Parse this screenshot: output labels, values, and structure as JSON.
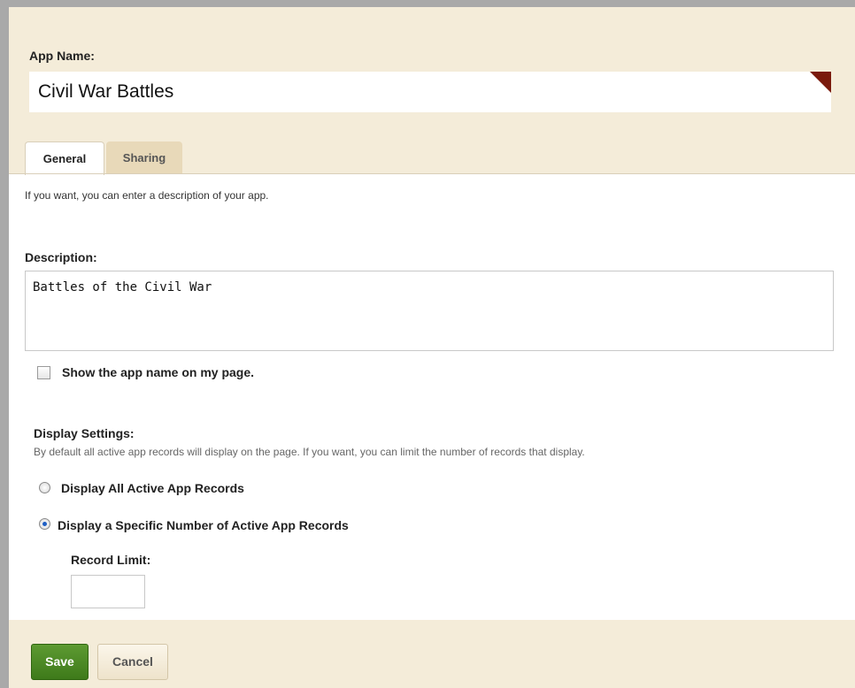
{
  "app_name": {
    "label": "App Name:",
    "value": "Civil War Battles"
  },
  "tabs": [
    {
      "label": "General",
      "active": true
    },
    {
      "label": "Sharing",
      "active": false
    }
  ],
  "general": {
    "intro": "If you want, you can enter a description of your app.",
    "description_label": "Description:",
    "description_value": "Battles of the Civil War",
    "show_name_label": "Show the app name on my page.",
    "show_name_checked": false
  },
  "display_settings": {
    "label": "Display Settings:",
    "help": "By default all active app records will display on the page. If you want, you can limit the number of records that display.",
    "options": [
      {
        "label": "Display All Active App Records",
        "selected": false
      },
      {
        "label": "Display a Specific Number of Active App Records",
        "selected": true
      }
    ],
    "record_limit_label": "Record Limit:",
    "record_limit_value": ""
  },
  "footer": {
    "save_label": "Save",
    "cancel_label": "Cancel"
  },
  "colors": {
    "panel_bg": "#f4ecd9",
    "required_flag": "#7a1a0c",
    "save_green": "#4a8a25"
  }
}
